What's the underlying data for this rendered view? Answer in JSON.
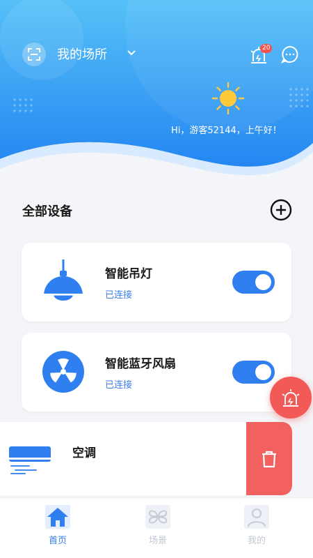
{
  "header": {
    "place_title": "我的场所",
    "alarm_badge": "20",
    "greeting": "Hi，游客52144，上午好！"
  },
  "section": {
    "title": "全部设备"
  },
  "devices": [
    {
      "name": "智能吊灯",
      "status": "已连接",
      "icon": "pendant-lamp-icon",
      "enabled": true
    },
    {
      "name": "智能蓝牙风扇",
      "status": "已连接",
      "icon": "fan-icon",
      "enabled": true
    },
    {
      "name": "空调",
      "icon": "air-conditioner-icon"
    }
  ],
  "tabs": [
    {
      "label": "首页",
      "icon": "home-icon",
      "active": true
    },
    {
      "label": "场景",
      "icon": "scene-grid-icon",
      "active": false
    },
    {
      "label": "我的",
      "icon": "profile-icon",
      "active": false
    }
  ],
  "colors": {
    "brand_blue": "#2f7ff0",
    "alert_red": "#f2605f",
    "header_gradient_top": "#5fc4f8",
    "header_gradient_bottom": "#2a8bf2"
  }
}
